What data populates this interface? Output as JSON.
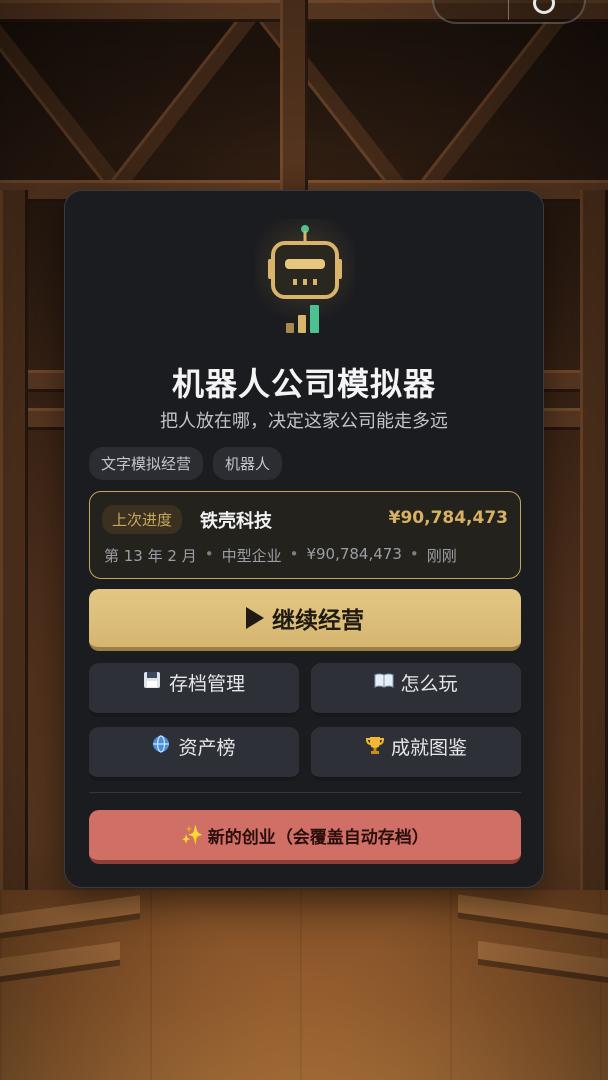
{
  "game": {
    "title": "机器人公司模拟器",
    "subtitle": "把人放在哪，决定这家公司能走多远",
    "tags": [
      "文字模拟经营",
      "机器人"
    ]
  },
  "last_progress": {
    "badge": "上次进度",
    "company": "铁壳科技",
    "money": "¥90,784,473",
    "meta": {
      "date": "第 13 年 2 月",
      "scale": "中型企业",
      "assets": "¥90,784,473",
      "saved": "刚刚"
    }
  },
  "buttons": {
    "continue": "继续经营",
    "saves": "存档管理",
    "how_to_play": "怎么玩",
    "leaderboard": "资产榜",
    "achievements": "成就图鉴",
    "new_game": "新的创业（会覆盖自动存档）"
  },
  "icons": {
    "logo": "robot-logo-icon",
    "continue": "play-icon",
    "saves": "floppy-disk-icon",
    "how_to_play": "open-book-icon",
    "leaderboard": "globe-icon",
    "achievements": "trophy-icon",
    "new_game": "sparkles-icon"
  },
  "colors": {
    "accent_gold": "#d9b163",
    "continue_bg": "#e2c783",
    "danger": "#d06f66",
    "card_bg": "#1b1c20"
  }
}
